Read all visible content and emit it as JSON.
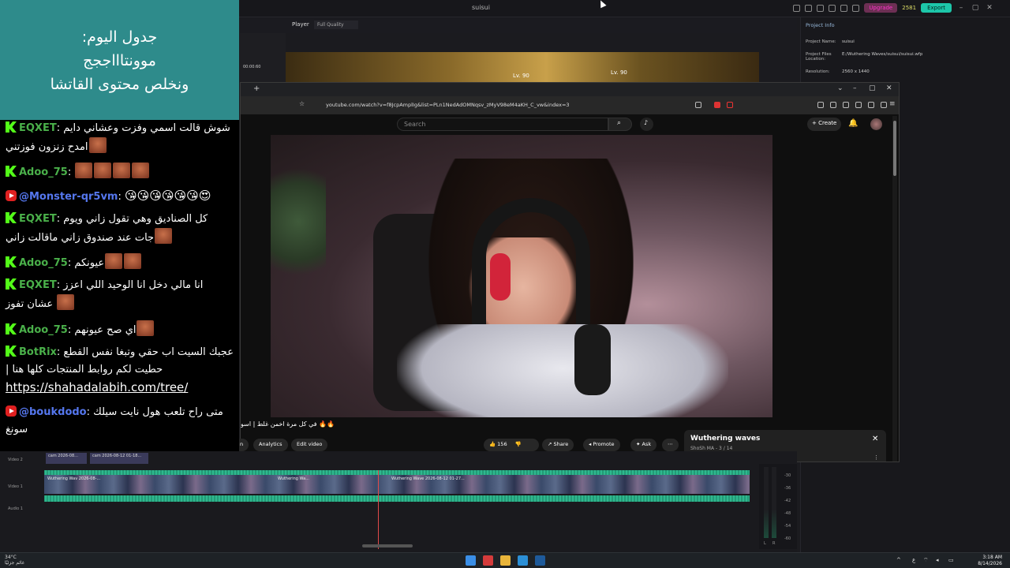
{
  "editor": {
    "title": "suisui",
    "player_label": "Player",
    "quality": "Full Quality",
    "upgrade": "Upgrade",
    "credits": "2581",
    "export": "Export",
    "timecode": "00:00:60",
    "preview_levels": [
      "Lv. 90",
      "Lv. 90"
    ]
  },
  "project_info": {
    "header": "Project Info",
    "rows": [
      {
        "key": "Project Name:",
        "value": "suisui"
      },
      {
        "key": "Project Files Location:",
        "value": "E:/Wuthering Waves/suisui/suisui.wfp"
      },
      {
        "key": "Resolution:",
        "value": "2560 x 1440"
      }
    ]
  },
  "schedule": {
    "lines": [
      "جدول اليوم:",
      "موونتاااججج",
      "ونخلص محتوى القاتشا"
    ]
  },
  "chat": [
    {
      "platform": "kick",
      "user": "EQXET",
      "text": "شوش قالت اسمي وفزت وعشاني دايم",
      "text2": "امدح زنزون فوزتني",
      "emotes": 1
    },
    {
      "platform": "kick",
      "user": "Adoo_75",
      "text": "",
      "emotes": 4
    },
    {
      "platform": "youtube",
      "user": "@Monster-qr5vm",
      "text": "😘😘😘😘😘😘😍",
      "emotes": 0
    },
    {
      "platform": "kick",
      "user": "EQXET",
      "text": "كل الصناديق وهي تقول زاني ويوم",
      "text2": "جات عند صندوق زاني ماقالت زاني",
      "emotes": 1
    },
    {
      "platform": "kick",
      "user": "Adoo_75",
      "text": "عيونكم",
      "emotes": 1
    },
    {
      "platform": "kick",
      "user": "EQXET",
      "text": "انا مالي دخل انا الوحيد اللي اعزز",
      "text2": "عشان تفوز",
      "emotes": 1
    },
    {
      "platform": "kick",
      "user": "Adoo_75",
      "text": "اي صح عيونهم",
      "emotes": 1
    },
    {
      "platform": "kick",
      "user": "BotRix",
      "text": "عجبك السيت اب حقي وتبغا نفس القطع",
      "text2": "حطيت لكم روابط المنتجات كلها هنا |",
      "link": "https://shahadalabih.com/tree/",
      "emotes": 0
    },
    {
      "platform": "youtube",
      "user": "@boukdodo",
      "text": "متى راح تلعب هول نايت سيلك",
      "text2": "سونغ",
      "emotes": 0
    }
  ],
  "browser": {
    "url": "youtube.com/watch?v=f8JcpAmplIg&list=PLn1NedAdOMNqsv_zMyV98eM4aKH_C_vw&index=3",
    "search_placeholder": "Search",
    "create_label": "Create",
    "video_title": "🔥🔥 في كل مرة اخمن غلط | اسو",
    "actions": {
      "join": "n",
      "analytics": "Analytics",
      "edit": "Edit video",
      "likes": "156",
      "share": "Share",
      "promote": "Promote",
      "ask": "Ask"
    },
    "playlist": {
      "title": "Wuthering waves",
      "subtitle": "ShoSh MA - 3 / 14"
    }
  },
  "timeline": {
    "tracks": [
      "Video 2",
      "Video 1",
      "Audio 1"
    ],
    "clips_v2": [
      "cam 2026-08...",
      "cam 2026-08-12 01-18..."
    ],
    "clips_v1": [
      "Wuthering Wav 2026-08-...",
      "Wuthering Wa...",
      "Wuthering Wave 2026-08-12 01-27..."
    ],
    "meter_db": [
      "-30",
      "-36",
      "-42",
      "-48",
      "-54",
      "-60"
    ],
    "meter_lr": [
      "L",
      "R"
    ]
  },
  "taskbar": {
    "weather_temp": "34°C",
    "weather_desc": "غائم جزئيًا",
    "time": "3:18 AM",
    "date": "8/14/2026",
    "lang": "ع"
  },
  "colors": {
    "schedule_bg": "#2e8b8b",
    "kick_green": "#53fc18",
    "yt_red": "#e02020",
    "export": "#1dc6a9"
  }
}
